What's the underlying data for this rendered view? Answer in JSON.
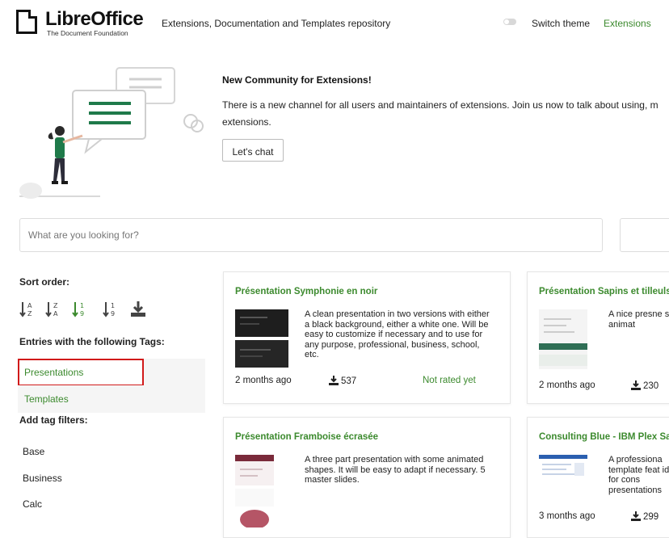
{
  "header": {
    "logo_name_part1": "Libre",
    "logo_name_part2": "Office",
    "logo_subtitle": "The Document Foundation",
    "title": "Extensions, Documentation and Templates repository",
    "switch_theme_label": "Switch theme",
    "extensions_link": "Extensions"
  },
  "banner": {
    "title": "New Community for Extensions!",
    "text_line1": "There is a new channel for all users and maintainers of extensions. Join us now to talk about using, m",
    "text_line2": "extensions.",
    "button_label": "Let's chat"
  },
  "search": {
    "placeholder": "What are you looking for?"
  },
  "sidebar": {
    "sort_label": "Sort order:",
    "tags_label": "Entries with the following Tags:",
    "tags": [
      "Presentations",
      "Templates"
    ],
    "add_filters_label": "Add tag filters:",
    "filters": [
      "Base",
      "Business",
      "Calc"
    ]
  },
  "cards": [
    {
      "title": "Présentation Symphonie en noir",
      "desc": "A clean presentation in two versions with either a black background, either a white one. Will be easy to customize if necessary and to use for any purpose, professional, business, school, etc.",
      "date": "2 months ago",
      "downloads": "537",
      "rating": "Not rated yet"
    },
    {
      "title": "Présentation Sapins et tilleuls",
      "desc": "A nice presne some animat",
      "date": "2 months ago",
      "downloads": "230",
      "rating": ""
    },
    {
      "title": "Présentation Framboise écrasée",
      "desc": "A three part presentation with some animated shapes. It will be easy to adapt if necessary. 5 master slides.",
      "date": "",
      "downloads": "",
      "rating": ""
    },
    {
      "title": "Consulting Blue - IBM Plex Sa",
      "desc": "A professiona template feat ideal for cons presentations",
      "date": "3 months ago",
      "downloads": "299",
      "rating": ""
    }
  ],
  "colors": {
    "accent_green": "#3c8a2e",
    "highlight_red": "#d11a1a"
  }
}
